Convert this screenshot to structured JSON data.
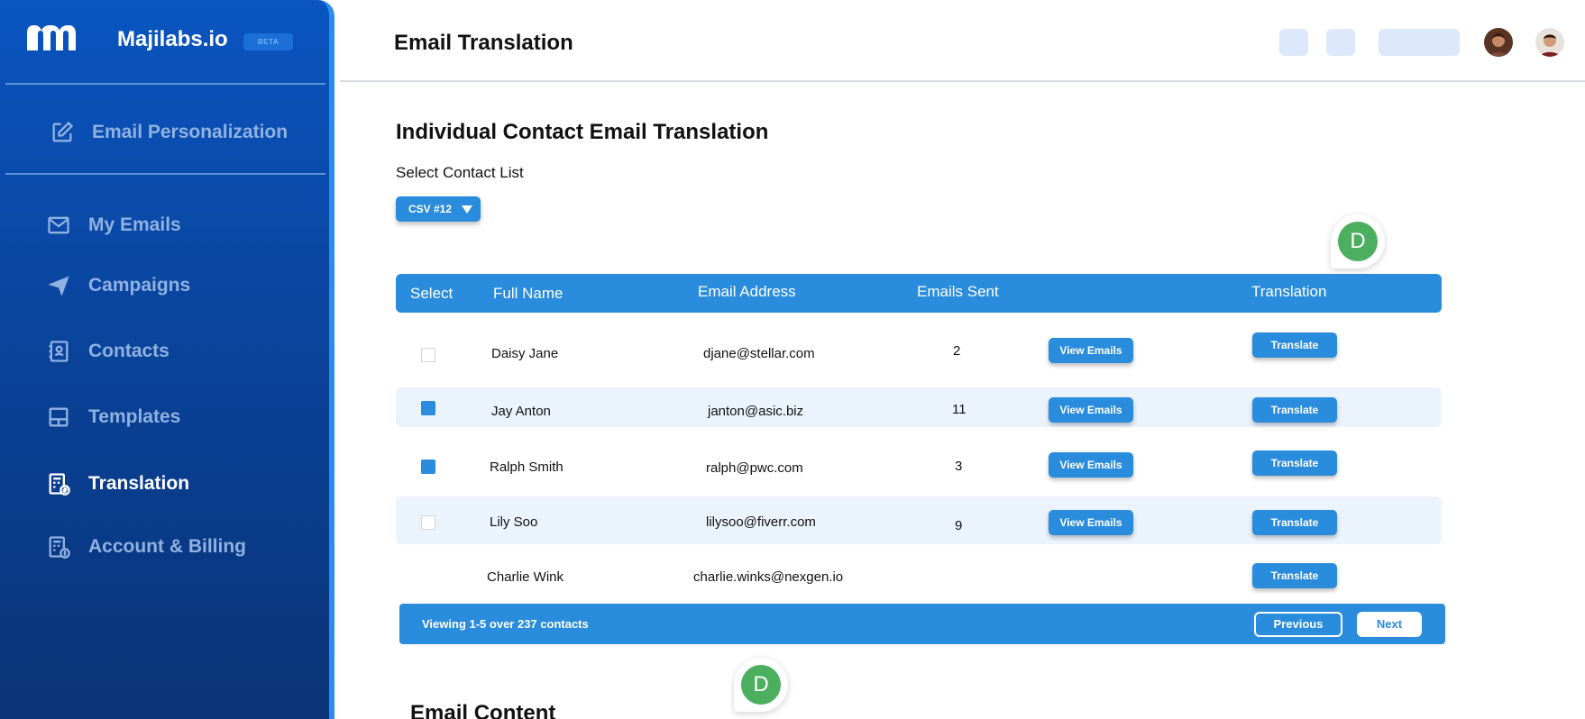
{
  "sidebar": {
    "brand": "Majilabs.io",
    "badge": "BETA",
    "top_item": "Email Personalization",
    "items": [
      {
        "label": "My Emails",
        "icon": "mail-icon"
      },
      {
        "label": "Campaigns",
        "icon": "send-icon"
      },
      {
        "label": "Contacts",
        "icon": "contacts-icon"
      },
      {
        "label": "Templates",
        "icon": "template-icon"
      },
      {
        "label": "Translation",
        "icon": "translation-icon",
        "active": true
      },
      {
        "label": "Account & Billing",
        "icon": "billing-icon"
      }
    ]
  },
  "header": {
    "title": "Email Translation"
  },
  "main": {
    "section_title": "Individual Contact Email Translation",
    "select_label": "Select Contact List",
    "select_value": "CSV #12",
    "avatar_letter": "D",
    "table": {
      "headers": [
        "Select",
        "Full Name",
        "Email Address",
        "Emails Sent",
        "Translation"
      ],
      "rows": [
        {
          "name": "Daisy Jane",
          "email": "djane@stellar.com",
          "sent": "2",
          "checked": false,
          "view": "View Emails",
          "translate": "Translate"
        },
        {
          "name": "Jay Anton",
          "email": "janton@asic.biz",
          "sent": "11",
          "checked": true,
          "view": "View Emails",
          "translate": "Translate"
        },
        {
          "name": "Ralph Smith",
          "email": "ralph@pwc.com",
          "sent": "3",
          "checked": true,
          "view": "View Emails",
          "translate": "Translate"
        },
        {
          "name": "Lily Soo",
          "email": "lilysoo@fiverr.com",
          "sent": "9",
          "checked": false,
          "view": "View Emails",
          "translate": "Translate"
        },
        {
          "name": "Charlie Wink",
          "email": "charlie.winks@nexgen.io",
          "sent": "",
          "checked": false,
          "view": "",
          "translate": "Translate"
        }
      ]
    },
    "pager": {
      "text": "Viewing 1-5 over 237 contacts",
      "previous": "Previous",
      "next": "Next"
    },
    "email_content_title": "Email Content"
  },
  "colors": {
    "primary": "#2a8cdc",
    "sidebar": "#0a55c0",
    "band": "#ebf3fd",
    "avatar_green": "#4caf5f"
  }
}
